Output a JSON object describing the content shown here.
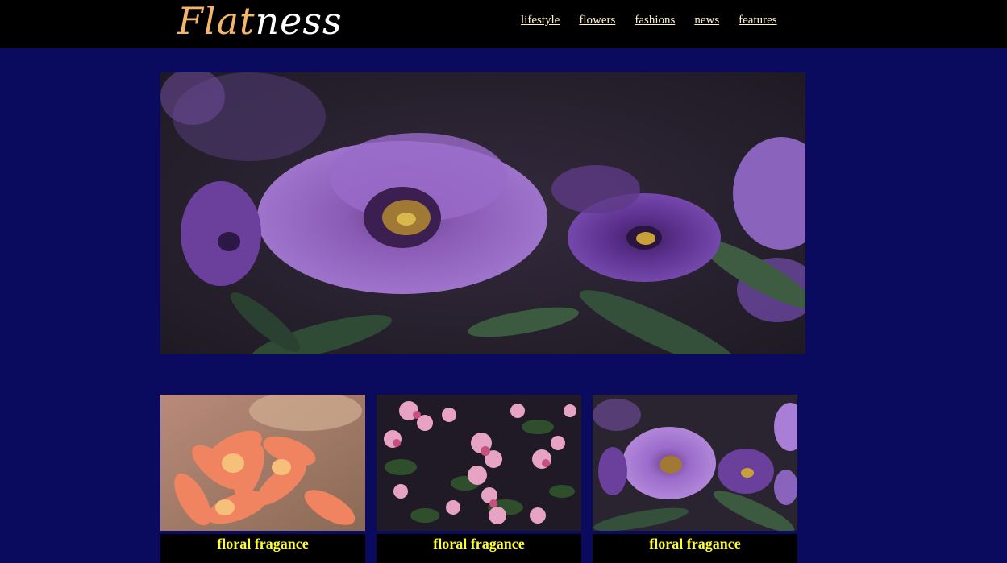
{
  "brand": {
    "part1": "Flat",
    "part2": "ness"
  },
  "nav": {
    "items": [
      "lifestyle",
      "flowers",
      "fashions",
      "news",
      "features"
    ]
  },
  "cards": [
    {
      "caption": "floral fragance"
    },
    {
      "caption": "floral fragance"
    },
    {
      "caption": "floral fragance"
    }
  ],
  "colors": {
    "background": "#0a0a5e",
    "header": "#000000",
    "caption_text": "#ffff2e",
    "logo_accent": "#f2b56b"
  }
}
